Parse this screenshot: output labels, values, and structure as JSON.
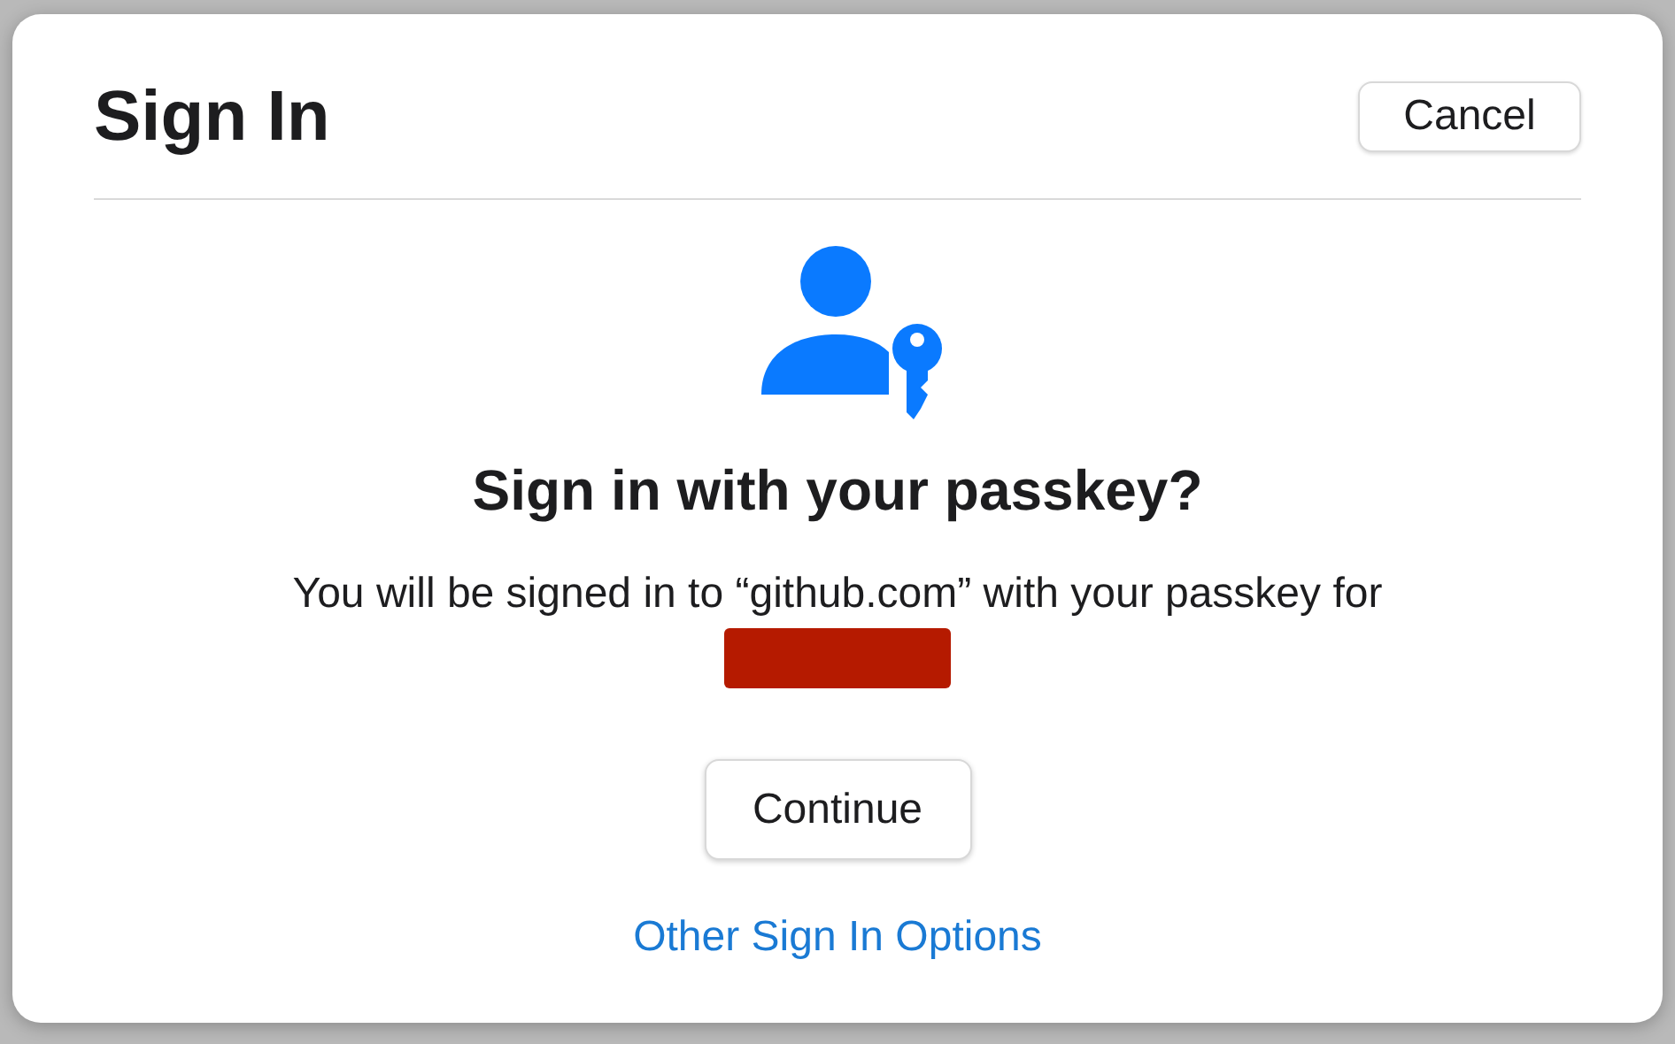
{
  "dialog": {
    "title": "Sign In",
    "cancel_button": "Cancel",
    "heading": "Sign in with your passkey?",
    "message": "You will be signed in to “github.com” with your passkey for",
    "continue_button": "Continue",
    "options_link": "Other Sign In Options"
  }
}
